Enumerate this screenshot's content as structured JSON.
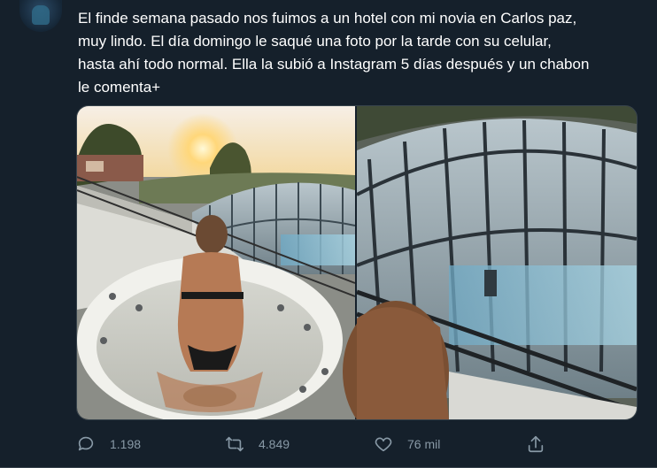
{
  "tweet": {
    "text": "El finde semana pasado nos fuimos a un hotel con mi novia en Carlos paz,\nmuy lindo. El día domingo le saqué una foto por la tarde con su celular,\nhasta ahí todo normal. Ella la subió a Instagram 5 días después y un chabon\nle comenta+"
  },
  "actions": {
    "reply_count": "1.198",
    "retweet_count": "4.849",
    "like_count": "76 mil"
  },
  "icons": {
    "reply": "comment-icon",
    "retweet": "retweet-icon",
    "like": "heart-icon",
    "share": "share-icon"
  },
  "colors": {
    "background": "#15202b",
    "text": "#ffffff",
    "secondary": "#8899a6",
    "border": "#38444d"
  }
}
